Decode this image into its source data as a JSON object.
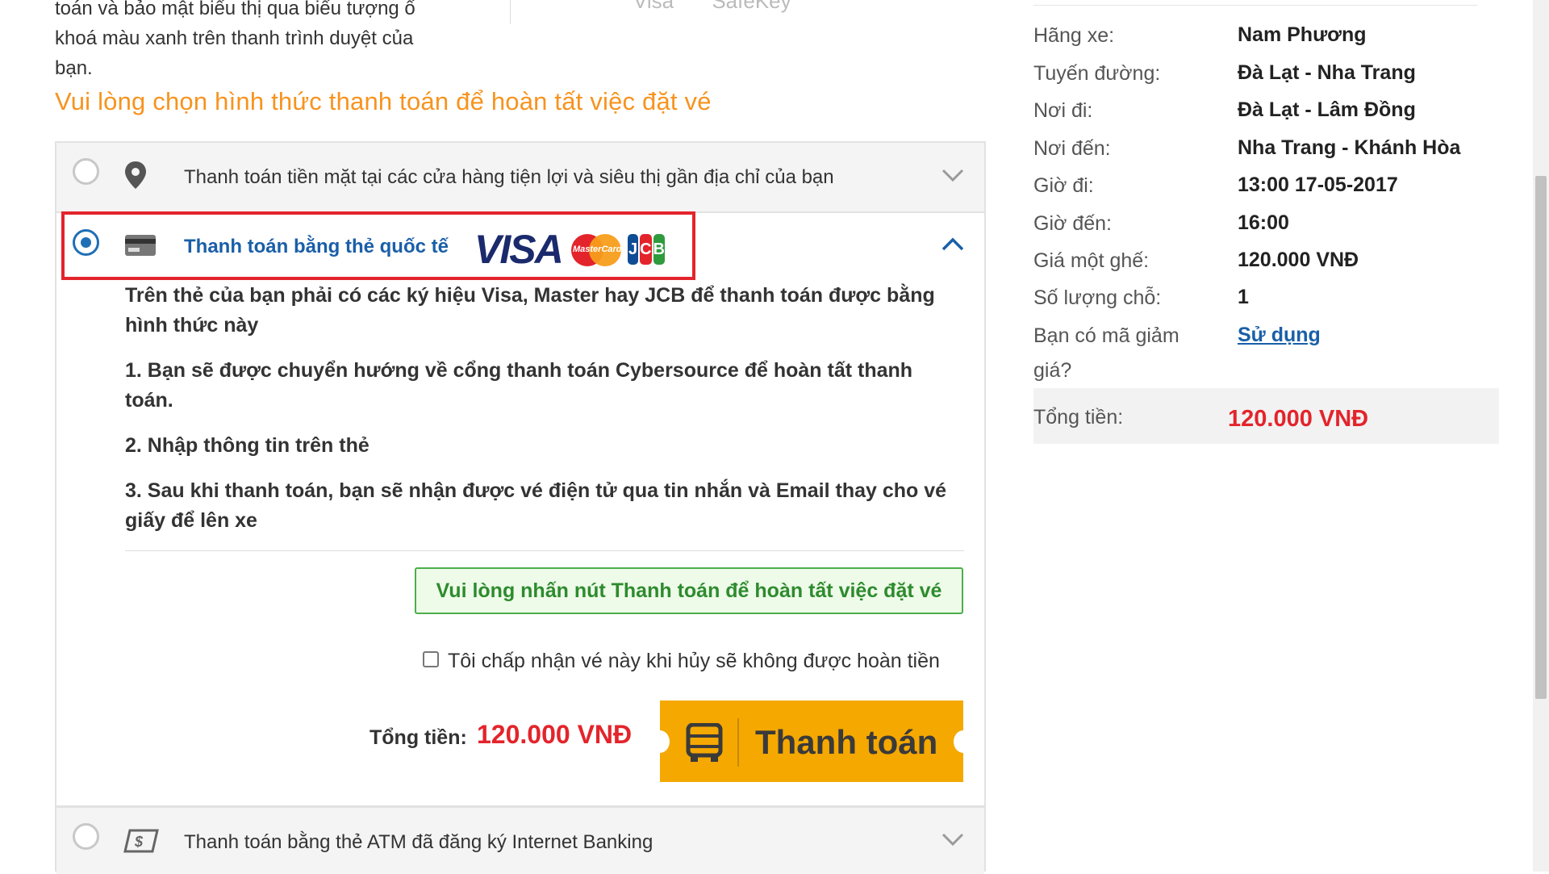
{
  "intro": {
    "line1": "toán và bảo mật biểu thị qua biểu tượng ổ",
    "line2": "khoá màu xanh trên thanh trình duyệt của",
    "line3": "bạn."
  },
  "secure_logos": [
    "Visa",
    "SafeKey"
  ],
  "section_title": "Vui lòng chọn hình thức thanh toán để hoàn tất việc đặt vé",
  "payment_options": {
    "cash": {
      "label": "Thanh toán tiền mặt tại các cửa hàng tiện lợi và siêu thị gần địa chỉ của bạn",
      "selected": false
    },
    "card": {
      "label": "Thanh toán bằng thẻ quốc tế",
      "selected": true,
      "logos": {
        "visa": "VISA",
        "mastercard": "MasterCard",
        "jcb": [
          "J",
          "C",
          "B"
        ]
      },
      "intro": "Trên thẻ của bạn phải có các ký hiệu Visa, Master hay JCB để thanh toán được bằng hình thức này",
      "step1": "1. Bạn sẽ được chuyển hướng về cổng thanh toán Cybersource để hoàn tất thanh toán.",
      "step2": "2. Nhập thông tin trên thẻ",
      "step3": "3. Sau khi thanh toán, bạn sẽ nhận được vé điện tử qua tin nhắn và Email thay cho vé giấy để lên xe",
      "notice": "Vui lòng nhấn nút Thanh toán để hoàn tất việc đặt vé",
      "accept_label": "Tôi chấp nhận vé này khi hủy sẽ không được hoàn tiền",
      "accept_checked": false,
      "total_label": "Tổng tiền:",
      "total_value": "120.000 VNĐ",
      "pay_button": "Thanh toán"
    },
    "atm": {
      "label": "Thanh toán bằng thẻ ATM đã đăng ký Internet Banking",
      "selected": false
    }
  },
  "summary": {
    "rows": [
      {
        "key": "Hãng xe:",
        "value": "Nam Phương"
      },
      {
        "key": "Tuyến đường:",
        "value": "Đà Lạt - Nha Trang"
      },
      {
        "key": "Nơi đi:",
        "value": "Đà Lạt - Lâm Đồng"
      },
      {
        "key": "Nơi đến:",
        "value": "Nha Trang - Khánh Hòa"
      },
      {
        "key": "Giờ đi:",
        "value": "13:00 17-05-2017"
      },
      {
        "key": "Giờ đến:",
        "value": "16:00"
      },
      {
        "key": "Giá một ghế:",
        "value": "120.000 VNĐ"
      },
      {
        "key": "Số lượng chỗ:",
        "value": "1"
      }
    ],
    "discount_key_line1": "Bạn có mã giảm",
    "discount_key_line2": "giá?",
    "discount_link": "Sử dụng",
    "total_key": "Tổng tiền:",
    "total_value": "120.000 VNĐ"
  },
  "colors": {
    "accent_orange": "#f7931e",
    "primary_blue": "#1a5fa8",
    "price_red": "#e3242b",
    "pay_button": "#f5a800",
    "notice_green": "#2e8b2e"
  }
}
